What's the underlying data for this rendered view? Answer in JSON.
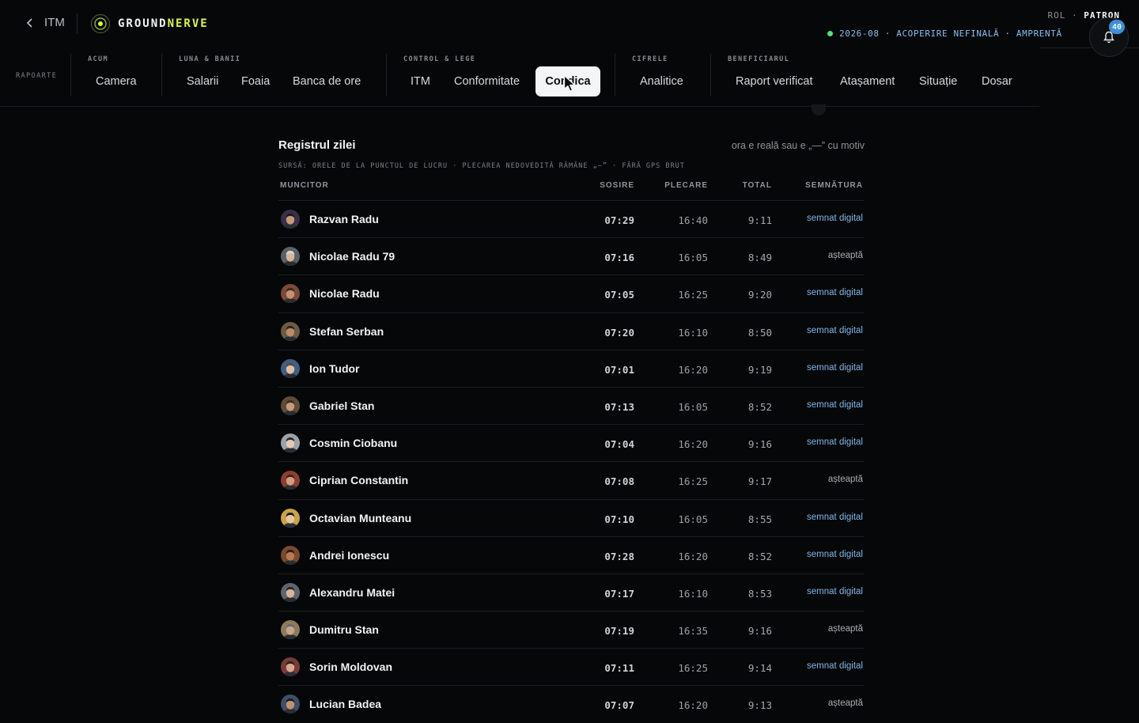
{
  "topbar": {
    "back_label": "ITM",
    "brand_part1": "GROUND",
    "brand_part2": "NERVE",
    "role_label": "ROL",
    "role_value": "PATRON",
    "status_text": "2026-08 · ACOPERIRE NEFINALĂ · AMPRENTĂ",
    "notifications_count": "40"
  },
  "nav": {
    "side_label": "RAPOARTE",
    "groups": [
      {
        "title": "ACUM",
        "items": [
          "Camera"
        ]
      },
      {
        "title": "LUNA & BANII",
        "items": [
          "Salarii",
          "Foaia",
          "Banca de ore"
        ]
      },
      {
        "title": "CONTROL & LEGE",
        "items": [
          "ITM",
          "Conformitate",
          "Condica"
        ]
      },
      {
        "title": "CIFRELE",
        "items": [
          "Analitice"
        ]
      },
      {
        "title": "BENEFICIARUL",
        "items": [
          "Raport verificat",
          "Atașament",
          "Situație",
          "Dosar"
        ]
      }
    ],
    "active_item": "Condica"
  },
  "panel": {
    "title": "Registrul zilei",
    "note": "ora e reală sau e „—” cu motiv",
    "subtitle": "SURSĂ: ORELE DE LA PUNCTUL DE LUCRU · PLECAREA NEDOVEDITĂ RĂMÂNE „—” · FĂRĂ GPS BRUT",
    "columns": {
      "worker": "MUNCITOR",
      "arrival": "SOSIRE",
      "departure": "PLECARE",
      "total": "TOTAL",
      "signature": "SEMNĂTURA"
    }
  },
  "rows": [
    {
      "name": "Razvan Radu",
      "in": "07:29",
      "out": "16:40",
      "total": "9:11",
      "sig": "semnat digital"
    },
    {
      "name": "Nicolae Radu 79",
      "in": "07:16",
      "out": "16:05",
      "total": "8:49",
      "sig": "așteaptă"
    },
    {
      "name": "Nicolae Radu",
      "in": "07:05",
      "out": "16:25",
      "total": "9:20",
      "sig": "semnat digital"
    },
    {
      "name": "Stefan Serban",
      "in": "07:20",
      "out": "16:10",
      "total": "8:50",
      "sig": "semnat digital"
    },
    {
      "name": "Ion Tudor",
      "in": "07:01",
      "out": "16:20",
      "total": "9:19",
      "sig": "semnat digital"
    },
    {
      "name": "Gabriel Stan",
      "in": "07:13",
      "out": "16:05",
      "total": "8:52",
      "sig": "semnat digital"
    },
    {
      "name": "Cosmin Ciobanu",
      "in": "07:04",
      "out": "16:20",
      "total": "9:16",
      "sig": "semnat digital"
    },
    {
      "name": "Ciprian Constantin",
      "in": "07:08",
      "out": "16:25",
      "total": "9:17",
      "sig": "așteaptă"
    },
    {
      "name": "Octavian Munteanu",
      "in": "07:10",
      "out": "16:05",
      "total": "8:55",
      "sig": "semnat digital"
    },
    {
      "name": "Andrei Ionescu",
      "in": "07:28",
      "out": "16:20",
      "total": "8:52",
      "sig": "semnat digital"
    },
    {
      "name": "Alexandru Matei",
      "in": "07:17",
      "out": "16:10",
      "total": "8:53",
      "sig": "semnat digital"
    },
    {
      "name": "Dumitru Stan",
      "in": "07:19",
      "out": "16:35",
      "total": "9:16",
      "sig": "așteaptă"
    },
    {
      "name": "Sorin Moldovan",
      "in": "07:11",
      "out": "16:25",
      "total": "9:14",
      "sig": "semnat digital"
    },
    {
      "name": "Lucian Badea",
      "in": "07:07",
      "out": "16:20",
      "total": "9:13",
      "sig": "așteaptă"
    }
  ],
  "colors": {
    "accent": "#d7f55a",
    "link": "#7fb6e8",
    "status": "#86bff0",
    "online": "#55e07a"
  }
}
